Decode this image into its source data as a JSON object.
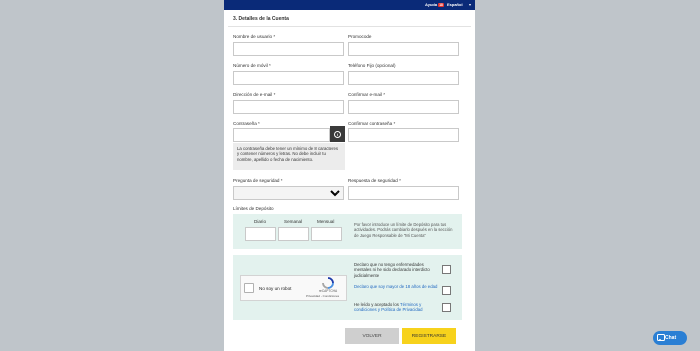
{
  "header": {
    "help_label": "Ayuda",
    "badge_label": "18",
    "language_label": "Español",
    "caret": "▾"
  },
  "section": {
    "title": "3. Detalles de la Cuenta"
  },
  "fields": {
    "username_label": "Nombre de usuario *",
    "promo_label": "Promocode",
    "mobile_label": "Número de móvil *",
    "landline_label": "Teléfono Fijo (opcional)",
    "email_label": "Dirección de e-mail *",
    "confirm_email_label": "Confirmar e-mail *",
    "password_label": "Contraseña *",
    "confirm_password_label": "Confirmar contraseña *",
    "password_tip": "La contraseña debe tener un mínimo de 8 caracteres y contener números y letras. No debe incluir tu nombre, apellido o fecha de nacimiento.",
    "security_question_label": "Pregunta de seguridad *",
    "security_answer_label": "Respuesta de seguridad *",
    "info_icon": "i"
  },
  "limits": {
    "title": "Límites de Depósito",
    "daily_label": "Diario",
    "weekly_label": "Semanal",
    "monthly_label": "Mensual",
    "note": "Por favor introduce un límite de Depósito para tus actividades. Podrás cambiarlo después en la sección de Juego Responsable de \"Mi Cuenta\""
  },
  "captcha": {
    "label": "No soy un robot",
    "brand": "reCAPTCHA",
    "links": "Privacidad - Condiciones"
  },
  "declarations": {
    "d1": "Declaro que no tengo enfermedades mentales ni he sido declarado interdicto judicialmente",
    "d2": "Declaro que soy mayor de 18 años de edad",
    "d3_prefix": "He leído y aceptado los ",
    "d3_link": "Términos y condiciones y Política de Privacidad"
  },
  "buttons": {
    "back": "VOLVER",
    "register": "REGISTRARSE"
  },
  "chat": {
    "label": "Chat"
  },
  "colors": {
    "topbar": "#0a2a78",
    "accent_yellow": "#f7d21c",
    "mint_box": "#e3f2ee",
    "chat_blue": "#2a7fd4"
  }
}
